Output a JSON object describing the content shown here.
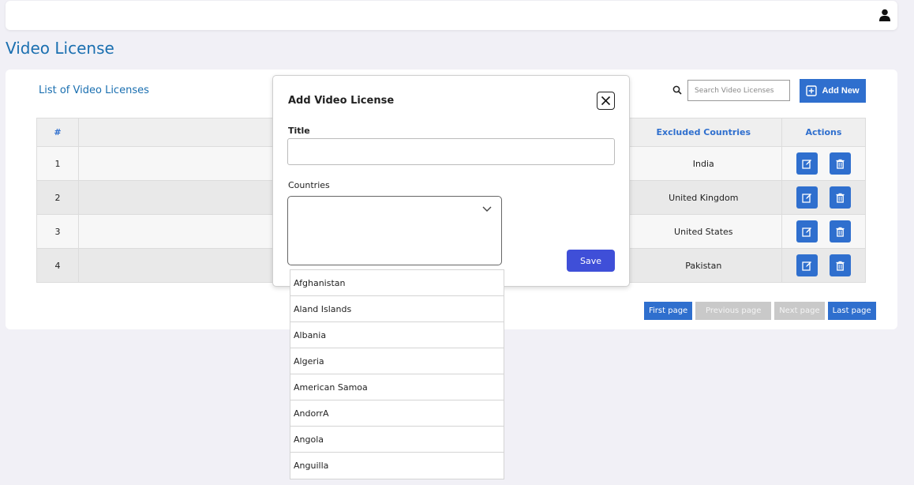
{
  "page": {
    "title": "Video License"
  },
  "list": {
    "title": "List of Video Licenses",
    "search_placeholder": "Search Video Licenses",
    "add_new_label": "Add New",
    "columns": {
      "num": "#",
      "title": "",
      "excluded": "Excluded Countries",
      "actions": "Actions"
    },
    "rows": [
      {
        "num": "1",
        "title": "",
        "excluded": "India"
      },
      {
        "num": "2",
        "title": "",
        "excluded": "United Kingdom"
      },
      {
        "num": "3",
        "title": "",
        "excluded": "United States"
      },
      {
        "num": "4",
        "title": "",
        "excluded": "Pakistan"
      }
    ]
  },
  "pagination": {
    "first": "First page",
    "previous": "Previous page",
    "next": "Next page",
    "last": "Last page"
  },
  "modal": {
    "title": "Add Video License",
    "title_label": "Title",
    "title_value": "",
    "countries_label": "Countries",
    "save_label": "Save"
  },
  "countries_options": [
    "Afghanistan",
    "Aland Islands",
    "Albania",
    "Algeria",
    "American Samoa",
    "AndorrA",
    "Angola",
    "Anguilla"
  ],
  "colors": {
    "accent": "#2f6fce",
    "title_blue": "#1a6fb0",
    "save": "#3f4fd8",
    "background": "#f1f0f6"
  },
  "icons": {
    "user": "user-icon",
    "search": "search-icon",
    "add": "plus-square-icon",
    "edit": "edit-icon",
    "delete": "trash-icon",
    "close": "close-icon",
    "chevron": "chevron-down-icon"
  }
}
